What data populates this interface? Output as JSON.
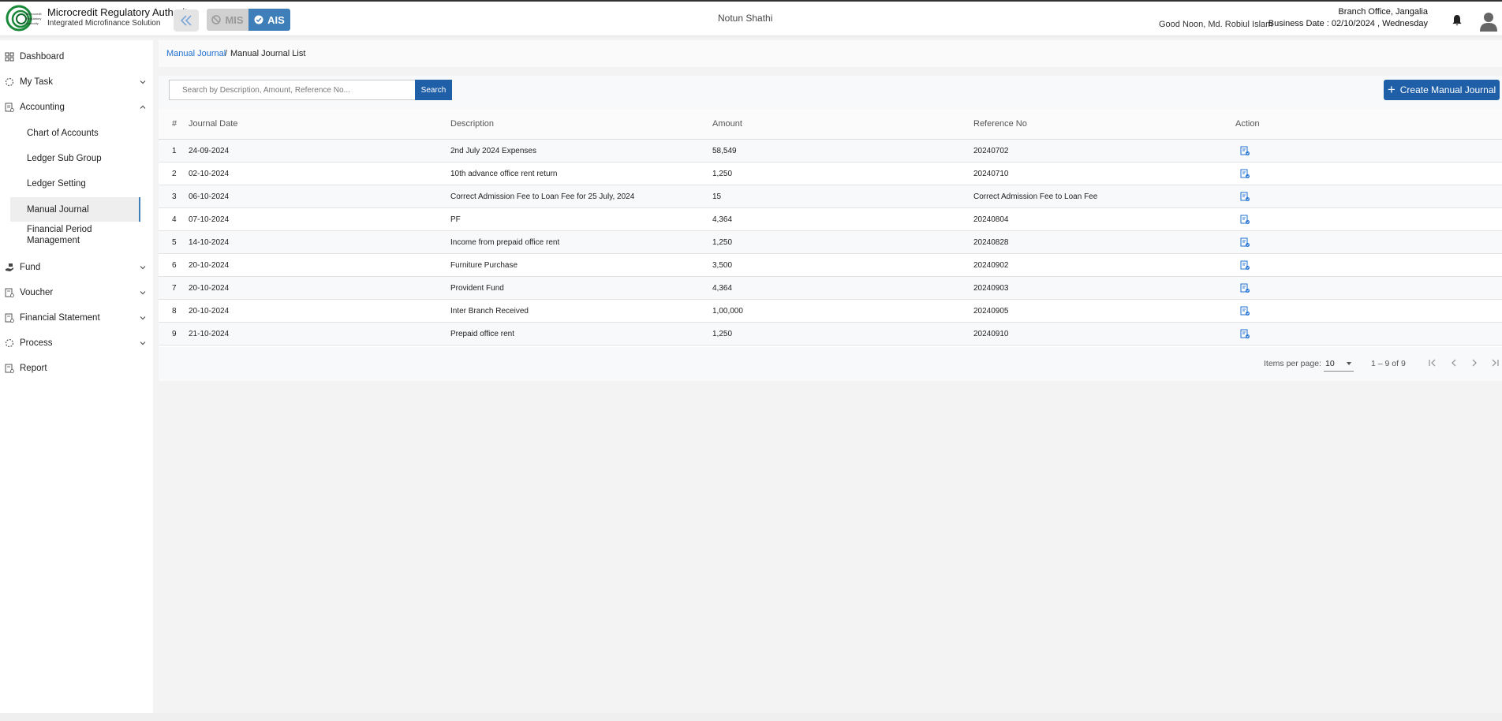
{
  "header": {
    "org_name": "Microcredit Regulatory Authority",
    "org_sub": "Integrated Microfinance Solution",
    "mis_label": "MIS",
    "ais_label": "AIS",
    "center_title": "Notun Shathi",
    "greeting": "Good Noon, Md. Robiul Islam",
    "branch": "Branch Office, Jangalia",
    "business_date": "Business Date : 02/10/2024 , Wednesday"
  },
  "sidebar": {
    "dashboard": "Dashboard",
    "my_task": "My Task",
    "accounting": "Accounting",
    "accounting_children": [
      "Chart of Accounts",
      "Ledger Sub Group",
      "Ledger Setting",
      "Manual Journal",
      "Financial Period Management"
    ],
    "fund": "Fund",
    "voucher": "Voucher",
    "financial_statement": "Financial Statement",
    "process": "Process",
    "report": "Report"
  },
  "breadcrumb": {
    "parent": "Manual Journal",
    "separator": "/",
    "current": "Manual Journal List"
  },
  "toolbar": {
    "search_placeholder": "Search by Description, Amount, Reference No...",
    "search_label": "Search",
    "create_label": "Create Manual Journal"
  },
  "table": {
    "headers": [
      "#",
      "Journal Date",
      "Description",
      "Amount",
      "Reference No",
      "Action"
    ],
    "rows": [
      [
        "1",
        "24-09-2024",
        "2nd July 2024 Expenses",
        "58,549",
        "20240702"
      ],
      [
        "2",
        "02-10-2024",
        "10th advance office rent return",
        "1,250",
        "20240710"
      ],
      [
        "3",
        "06-10-2024",
        "Correct Admission Fee to Loan Fee for 25 July, 2024",
        "15",
        "Correct Admission Fee to Loan Fee"
      ],
      [
        "4",
        "07-10-2024",
        "PF",
        "4,364",
        "20240804"
      ],
      [
        "5",
        "14-10-2024",
        "Income from prepaid office rent",
        "1,250",
        "20240828"
      ],
      [
        "6",
        "20-10-2024",
        "Furniture Purchase",
        "3,500",
        "20240902"
      ],
      [
        "7",
        "20-10-2024",
        "Provident Fund",
        "4,364",
        "20240903"
      ],
      [
        "8",
        "20-10-2024",
        "Inter Branch Received",
        "1,00,000",
        "20240905"
      ],
      [
        "9",
        "21-10-2024",
        "Prepaid office rent",
        "1,250",
        "20240910"
      ]
    ]
  },
  "paginator": {
    "items_per_page_label": "Items per page:",
    "page_size": "10",
    "range": "1 – 9 of 9"
  },
  "colors": {
    "primary": "#1f5fa8",
    "link": "#1f6fd1",
    "ais": "#3e7fba"
  }
}
